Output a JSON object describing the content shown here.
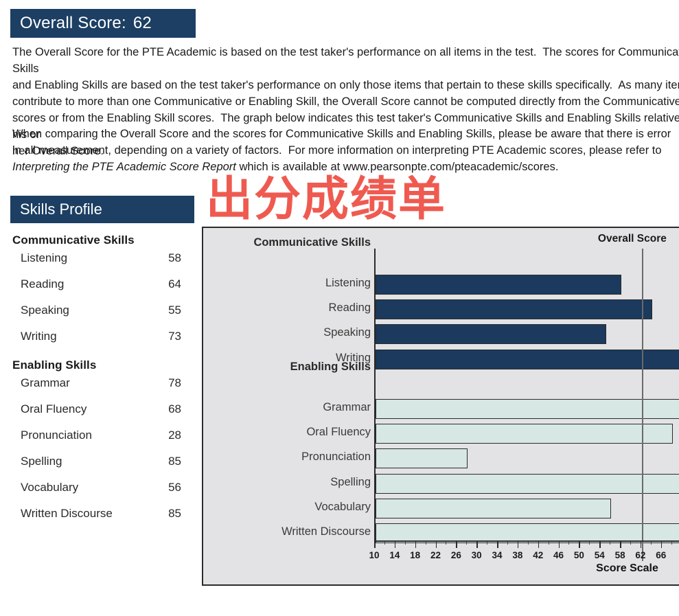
{
  "overall": {
    "label": "Overall Score:",
    "value": "62"
  },
  "paragraphs": {
    "p1": "The Overall Score for the PTE Academic is based on the test taker's performance on all items in the test.  The scores for Communicative Skills\nand Enabling Skills are based on the test taker's performance on only those items that pertain to these skills specifically.  As many items\ncontribute to more than one Communicative or Enabling Skill, the Overall Score cannot be computed directly from the Communicative Skill\nscores or from the Enabling Skill scores.  The graph below indicates this test taker's Communicative Skills and Enabling Skills relative to his or\nher Overall Score.",
    "p2_before": "When comparing the Overall Score and the scores for Communicative Skills and Enabling Skills, please be aware that there is error\nin all measurement, depending on a variety of factors.  For more information on interpreting PTE Academic scores, please refer to\n",
    "p2_italic": "Interpreting the PTE Academic Score Report",
    "p2_after": " which is available at www.pearsonpte.com/pteacademic/scores."
  },
  "skills_profile": {
    "title": "Skills Profile",
    "communicative_heading": "Communicative Skills",
    "enabling_heading": "Enabling Skills",
    "communicative": [
      {
        "name": "Listening",
        "score": "58"
      },
      {
        "name": "Reading",
        "score": "64"
      },
      {
        "name": "Speaking",
        "score": "55"
      },
      {
        "name": "Writing",
        "score": "73"
      }
    ],
    "enabling": [
      {
        "name": "Grammar",
        "score": "78"
      },
      {
        "name": "Oral Fluency",
        "score": "68"
      },
      {
        "name": "Pronunciation",
        "score": "28"
      },
      {
        "name": "Spelling",
        "score": "85"
      },
      {
        "name": "Vocabulary",
        "score": "56"
      },
      {
        "name": "Written Discourse",
        "score": "85"
      }
    ]
  },
  "watermark": {
    "text": "出分成绩单",
    "color": "#ef5a50"
  },
  "chart_data": {
    "type": "bar",
    "orientation": "horizontal",
    "title": "",
    "xlabel": "Score Scale",
    "ylabel": "",
    "xlim": [
      10,
      90
    ],
    "xticks": [
      10,
      14,
      18,
      22,
      26,
      30,
      34,
      38,
      42,
      46,
      50,
      54,
      58,
      62,
      66
    ],
    "xtick_labels": [
      "10",
      "14",
      "18",
      "22",
      "26",
      "30",
      "34",
      "38",
      "42",
      "46",
      "50",
      "54",
      "58",
      "62",
      "66"
    ],
    "grid": false,
    "legend": false,
    "groups": [
      {
        "name": "Communicative Skills",
        "color": "#1b3a5e",
        "categories": [
          "Listening",
          "Reading",
          "Speaking",
          "Writing"
        ],
        "values": [
          58,
          64,
          55,
          73
        ]
      },
      {
        "name": "Enabling Skills",
        "color": "#d7e7e3",
        "categories": [
          "Grammar",
          "Oral Fluency",
          "Pronunciation",
          "Spelling",
          "Vocabulary",
          "Written Discourse"
        ],
        "values": [
          78,
          68,
          28,
          85,
          56,
          85
        ]
      }
    ],
    "reference_line": {
      "label": "Overall Score",
      "value": 62,
      "color": "#6a6a6a"
    },
    "axis_title": "Score Scale"
  },
  "theme": {
    "header_bar": "#1c3f63",
    "panel_bg": "#e3e3e5",
    "comm_bar": "#1b3a5e",
    "enab_bar": "#d7e7e3",
    "border": "#2b2b2b"
  }
}
